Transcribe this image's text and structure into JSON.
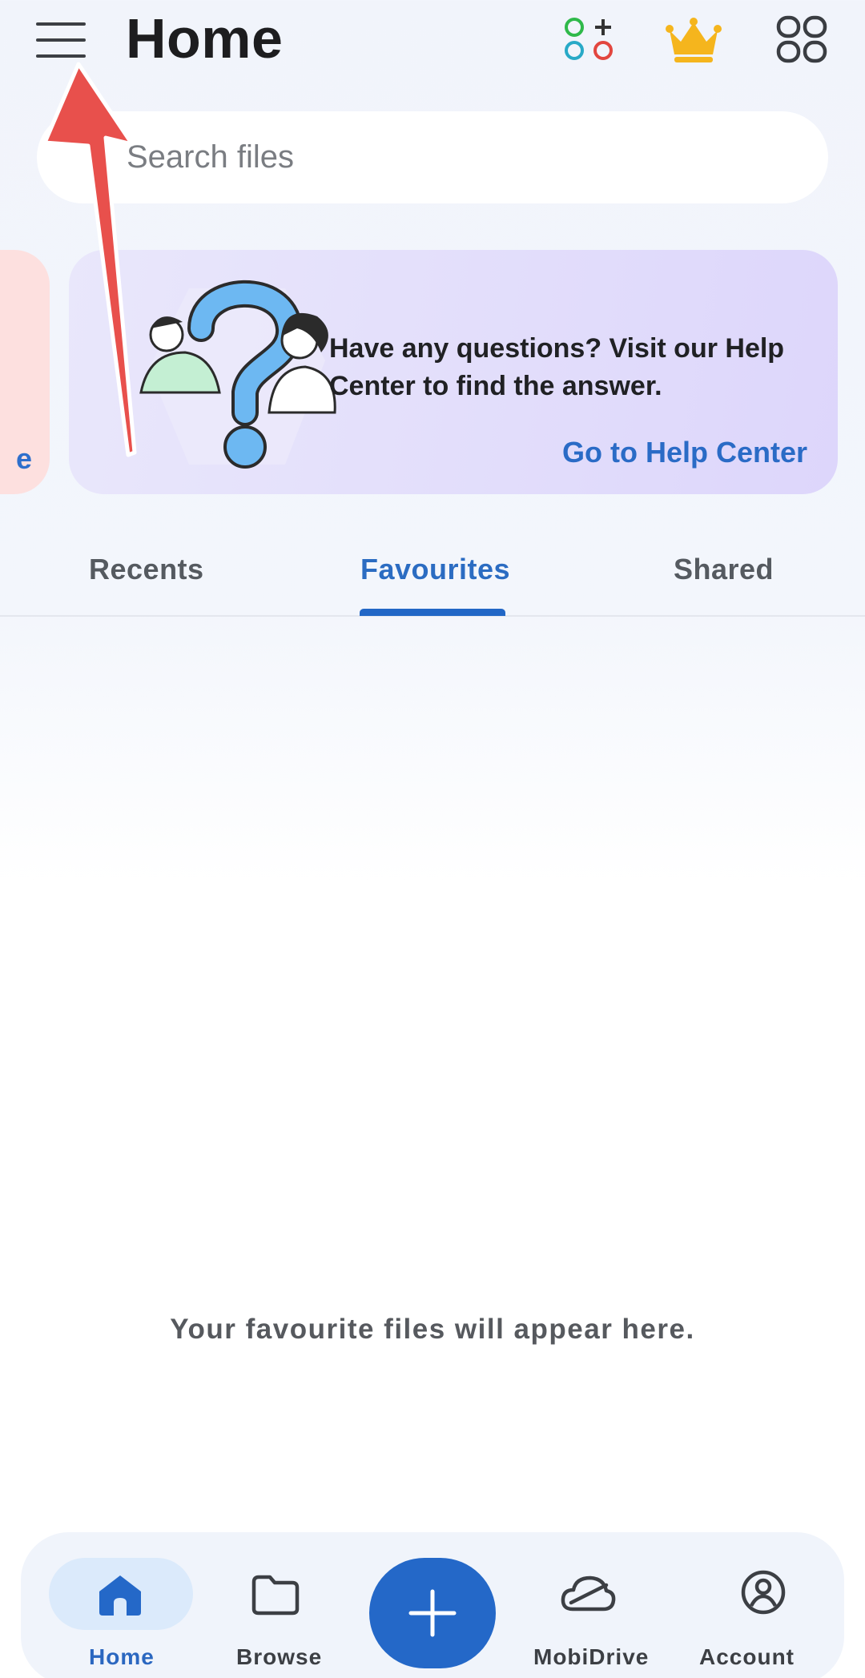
{
  "header": {
    "title": "Home",
    "icons": [
      "menu-icon",
      "apps-icon",
      "premium-crown-icon",
      "grid-view-icon"
    ]
  },
  "search": {
    "placeholder": "Search files"
  },
  "banner": {
    "prev_edge_text": "e",
    "help_text": "Have any questions? Visit our Help Center to find the answer.",
    "help_link": "Go to Help Center"
  },
  "tabs": [
    {
      "label": "Recents",
      "active": false
    },
    {
      "label": "Favourites",
      "active": true
    },
    {
      "label": "Shared",
      "active": false
    }
  ],
  "empty_state": {
    "message": "Your favourite files will appear here."
  },
  "bottom_nav": {
    "items": [
      {
        "label": "Home",
        "icon": "home-icon",
        "active": true
      },
      {
        "label": "Browse",
        "icon": "folder-icon",
        "active": false
      },
      {
        "label": "MobiDrive",
        "icon": "cloud-icon",
        "active": false
      },
      {
        "label": "Account",
        "icon": "account-icon",
        "active": false
      }
    ],
    "fab_icon": "plus-icon"
  },
  "colors": {
    "accent": "#2468c8",
    "annotation_arrow": "#e8504c",
    "crown": "#f5b51d",
    "help_card": "#e3ddfb",
    "prev_card": "#fde0df"
  }
}
